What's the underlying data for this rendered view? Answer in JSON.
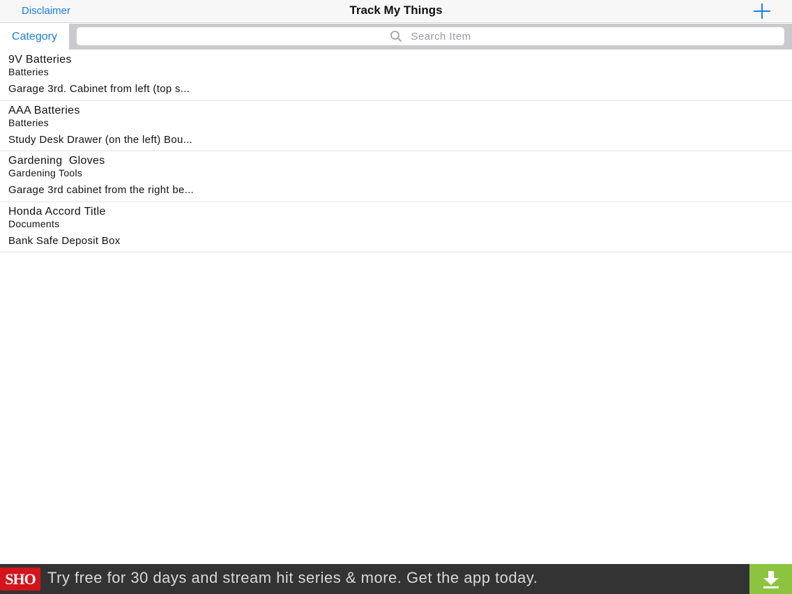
{
  "navbar": {
    "left_button": "Disclaimer",
    "title": "Track My Things",
    "add_icon": "plus-icon"
  },
  "search": {
    "category_button": "Category",
    "placeholder": "Search Item",
    "icon": "search-icon"
  },
  "items": [
    {
      "name": "9V Batteries",
      "category": "Batteries",
      "location": "Garage 3rd. Cabinet from left (top s..."
    },
    {
      "name": "AAA Batteries",
      "category": "Batteries",
      "location": "Study Desk Drawer (on the left) Bou..."
    },
    {
      "name": "Gardening  Gloves",
      "category": "Gardening Tools",
      "location": "Garage 3rd cabinet from the right be..."
    },
    {
      "name": "Honda Accord Title",
      "category": "Documents",
      "location": "Bank Safe Deposit Box"
    }
  ],
  "ad": {
    "logo_text": "SHO",
    "text": "Try free for 30 days and stream hit series & more. Get the app today.",
    "download_icon": "download-icon"
  },
  "colors": {
    "accent": "#1a7ef0",
    "ad_background": "#333333",
    "ad_logo": "#d5131b",
    "ad_download": "#8cc43f"
  }
}
